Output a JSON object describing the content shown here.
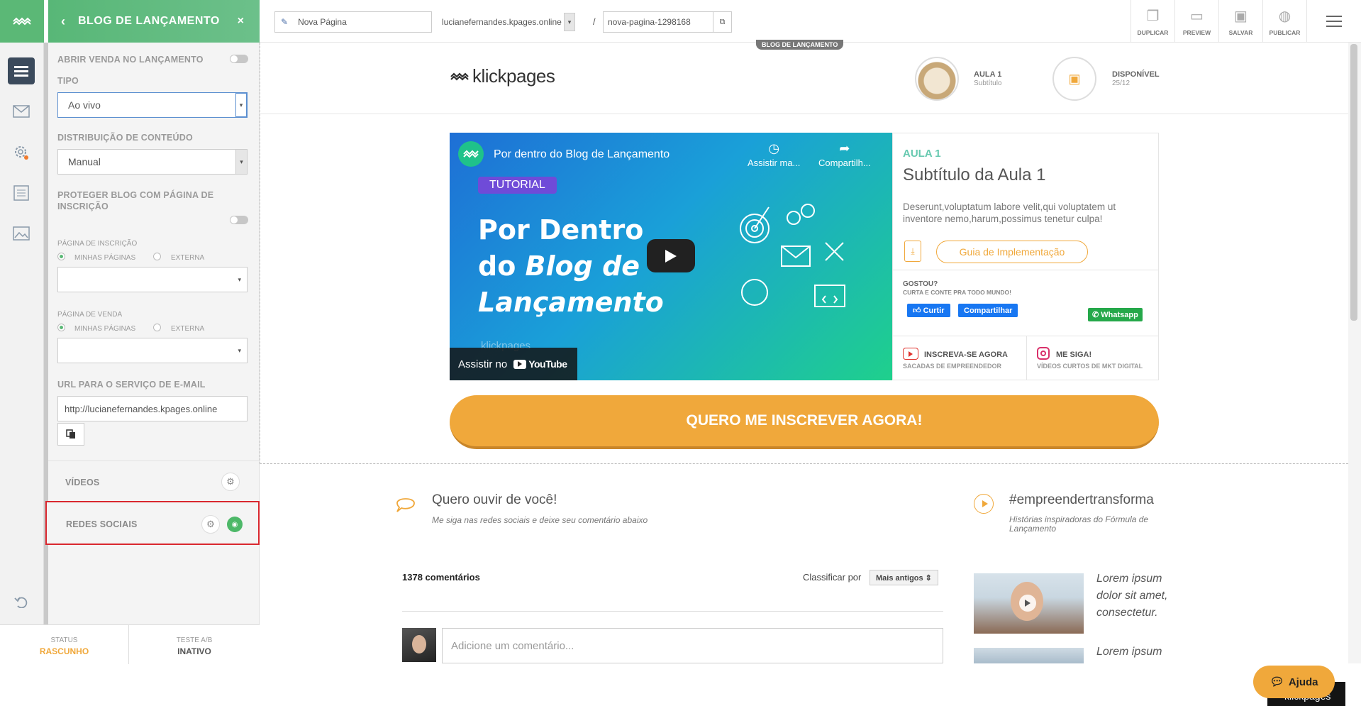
{
  "rail": {
    "items": [
      "menu-icon",
      "mail-icon",
      "gear-icon",
      "list-icon",
      "image-icon",
      "undo-icon"
    ]
  },
  "panel": {
    "title": "BLOG DE LANÇAMENTO",
    "abrir_venda": "ABRIR VENDA NO LANÇAMENTO",
    "tipo_label": "TIPO",
    "tipo_value": "Ao vivo",
    "distrib_label": "DISTRIBUIÇÃO DE CONTEÚDO",
    "distrib_value": "Manual",
    "proteger_label": "PROTEGER BLOG COM PÁGINA DE INSCRIÇÃO",
    "inscricao_label": "PÁGINA DE INSCRIÇÃO",
    "venda_label": "PÁGINA DE VENDA",
    "opt_minhas": "MINHAS PÁGINAS",
    "opt_externa": "EXTERNA",
    "url_label": "URL PARA O SERVIÇO DE E-MAIL",
    "url_value": "http://lucianefernandes.kpages.online",
    "videos_label": "VÍDEOS",
    "redes_label": "REDES SOCIAIS"
  },
  "status": {
    "status_label": "STATUS",
    "status_value": "RASCUNHO",
    "ab_label": "TESTE A/B",
    "ab_value": "INATIVO"
  },
  "topbar": {
    "page_name": "Nova Página",
    "domain": "lucianefernandes.kpages.online",
    "slash": "/",
    "slug": "nova-pagina-1298168",
    "tools": [
      "DUPLICAR",
      "PREVIEW",
      "SALVAR",
      "PUBLICAR"
    ]
  },
  "page": {
    "section_tag": "BLOG DE LANÇAMENTO",
    "logo_text": "klickpages",
    "aula_title": "AULA 1",
    "aula_sub": "Subtítulo",
    "disp_title": "DISPONÍVEL",
    "disp_date": "25/12",
    "video": {
      "title": "Por dentro do Blog de Lançamento",
      "watch_later": "Assistir ma...",
      "share": "Compartilh...",
      "tag": "TUTORIAL",
      "headline_1": "Por Dentro",
      "headline_2": "do ",
      "headline_2b": "Blog de",
      "headline_3": "Lançamento",
      "watermark": "klickpages",
      "watch_on": "Assistir no",
      "youtube": "YouTube"
    },
    "lesson": {
      "kicker": "AULA 1",
      "title": "Subtítulo da Aula 1",
      "desc": "Deserunt,voluptatum labore velit,qui voluptatem ut inventore nemo,harum,possimus tenetur culpa!",
      "guide_btn": "Guia de Implementação",
      "gostou": "GOSTOU?",
      "gostou_sub": "CURTA E CONTE PRA TODO MUNDO!",
      "curtir": "Curtir",
      "compartilhar": "Compartilhar",
      "whatsapp": "Whatsapp",
      "inscreva": "INSCREVA-SE AGORA",
      "inscreva_sub": "SACADAS DE EMPREENDEDOR",
      "siga": "ME SIGA!",
      "siga_sub": "VÍDEOS CURTOS DE MKT DIGITAL"
    },
    "cta": "QUERO ME INSCREVER AGORA!",
    "comments": {
      "heading": "Quero ouvir de você!",
      "sub": "Me siga nas redes sociais e deixe seu comentário abaixo",
      "count": "1378 comentários",
      "sort_label": "Classificar por",
      "sort_value": "Mais antigos ⇕",
      "placeholder": "Adicione um comentário..."
    },
    "side": {
      "hashtag": "#empreendertransforma",
      "hashtag_sub": "Histórias inspiradoras do Fórmula de Lançamento",
      "item1": "Lorem ipsum dolor sit amet, consectetur.",
      "item2": "Lorem ipsum"
    },
    "help": "Ajuda",
    "badge": "klickpages"
  },
  "colors": {
    "green": "#5bb876",
    "orange": "#f0a83b",
    "red_highlight": "#d9272e"
  }
}
